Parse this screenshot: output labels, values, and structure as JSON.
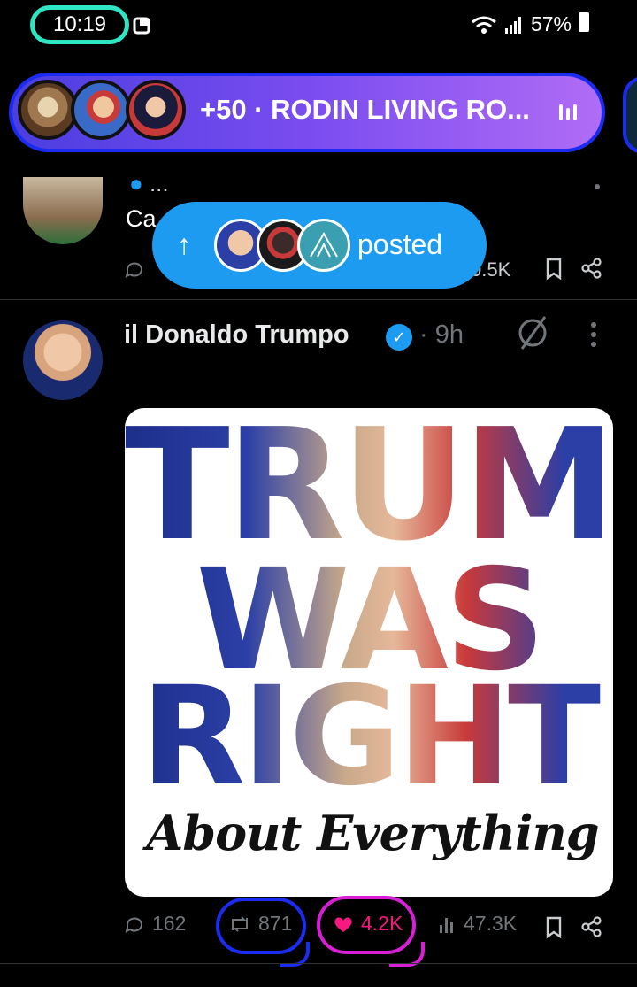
{
  "status_bar": {
    "time": "10:19",
    "battery": "57%"
  },
  "spaces_bar": {
    "text": "+50 · RODIN LIVING RO..."
  },
  "previous_tweet": {
    "name_fragment": "...",
    "text_fragment": "Ca",
    "views_fragment": "0.5K"
  },
  "posted_toast": {
    "label": "posted"
  },
  "tweet": {
    "author_name": "il Donaldo Trumpo",
    "time": "· 9h",
    "image_text": {
      "line1": "TRUMP",
      "line2": "WAS",
      "line3": "RIGHT",
      "script": "About Everything"
    },
    "actions": {
      "replies": "162",
      "reposts": "871",
      "likes": "4.2K",
      "views": "47.3K"
    }
  },
  "colors": {
    "accent_blue": "#1d9bf0",
    "like_pink": "#f91880",
    "annotation_teal": "#2ee6c4",
    "annotation_blue": "#1b2cf0",
    "annotation_magenta": "#d81fd6"
  }
}
